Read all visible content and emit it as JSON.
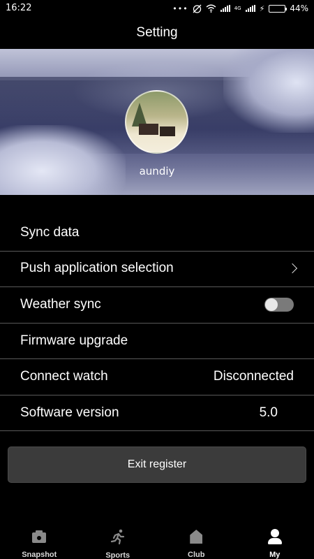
{
  "status_bar": {
    "time": "16:22",
    "battery": "44%",
    "battery_level": 0.44,
    "network": "4G"
  },
  "header": {
    "title": "Setting"
  },
  "profile": {
    "username": "aundiy"
  },
  "settings": {
    "sync_data": {
      "label": "Sync data"
    },
    "push_app": {
      "label": "Push application selection"
    },
    "weather_sync": {
      "label": "Weather sync",
      "enabled": false
    },
    "firmware": {
      "label": "Firmware upgrade"
    },
    "connect_watch": {
      "label": "Connect watch",
      "value": "Disconnected"
    },
    "software_version": {
      "label": "Software version",
      "value": "5.0"
    }
  },
  "exit_button": {
    "label": "Exit register"
  },
  "bottom_nav": {
    "snapshot": {
      "label": "Snapshot",
      "icon": "camera-icon"
    },
    "sports": {
      "label": "Sports",
      "icon": "runner-icon"
    },
    "club": {
      "label": "Club",
      "icon": "home-icon"
    },
    "my": {
      "label": "My",
      "icon": "person-icon",
      "active": true
    }
  },
  "colors": {
    "background": "#000000",
    "divider": "#5a5a5a",
    "button_bg": "#3b3b3b",
    "battery_fill": "#37c837",
    "inactive_icon": "#8a8a8a"
  }
}
